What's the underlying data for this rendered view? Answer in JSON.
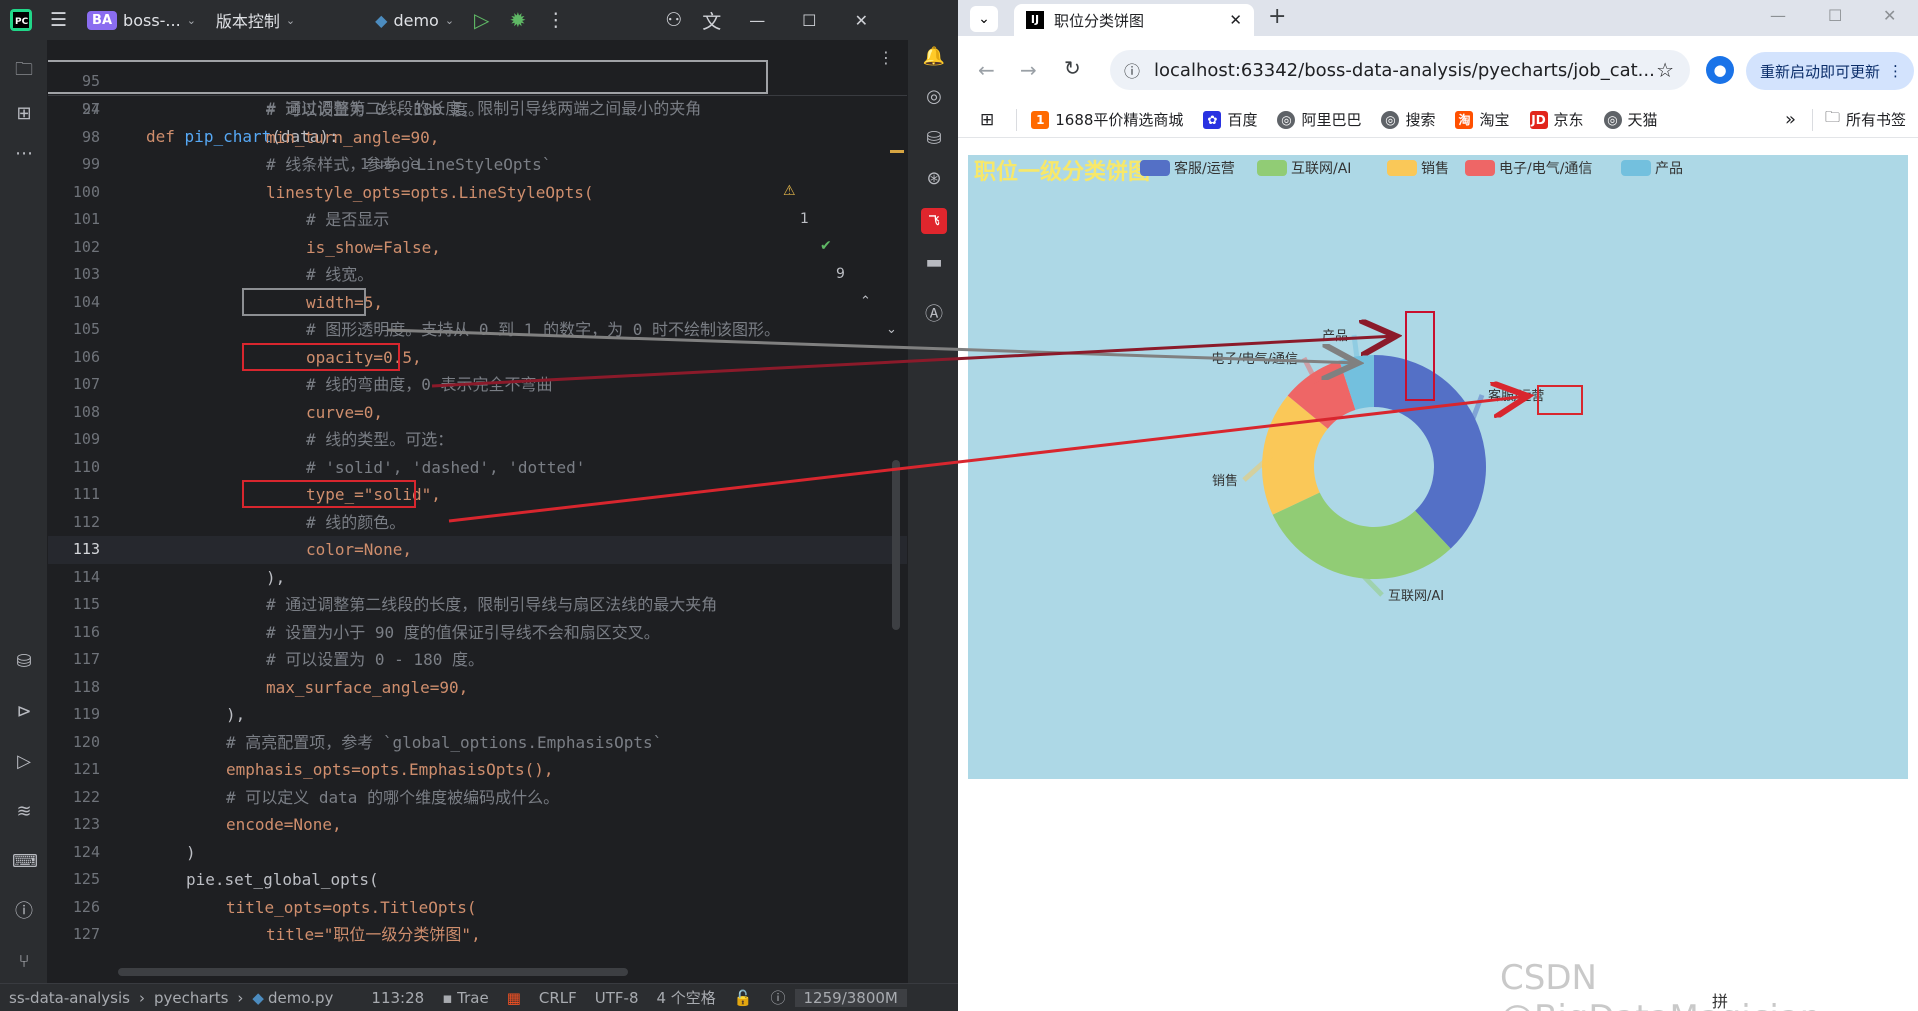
{
  "ide": {
    "titlebar": {
      "project_badge": "BA",
      "project_name": "boss-...",
      "vcs": "版本控制",
      "run_config": "demo"
    },
    "sticky": {
      "line1_num": "95",
      "line1_code": "# 通过调整第二线段的长度，限制引导线两端之间最小的夹角",
      "line2_num": "24",
      "line2_def": "def",
      "line2_fn": "pip_chart",
      "line2_rest": "(data):",
      "line2_usage": "1 usage",
      "warnings": "1",
      "checks": "9"
    },
    "lines": [
      {
        "n": "97",
        "code": "# 可以设置为 0 - 180 度。"
      },
      {
        "n": "98",
        "code": "min_turn_angle=90,"
      },
      {
        "n": "99",
        "code": "# 线条样式，参考 `LineStyleOpts`"
      },
      {
        "n": "100",
        "code": "linestyle_opts=opts.LineStyleOpts("
      },
      {
        "n": "101",
        "code": "# 是否显示"
      },
      {
        "n": "102",
        "code": "is_show=False,"
      },
      {
        "n": "103",
        "code": "# 线宽。"
      },
      {
        "n": "104",
        "code": "width=5,"
      },
      {
        "n": "105",
        "code": "# 图形透明度。支持从 0 到 1 的数字，为 0 时不绘制该图形。"
      },
      {
        "n": "106",
        "code": "opacity=0.5,"
      },
      {
        "n": "107",
        "code": "# 线的弯曲度，0 表示完全不弯曲"
      },
      {
        "n": "108",
        "code": "curve=0,"
      },
      {
        "n": "109",
        "code": "# 线的类型。可选："
      },
      {
        "n": "110",
        "code": "# 'solid', 'dashed', 'dotted'"
      },
      {
        "n": "111",
        "code": "type_=\"solid\","
      },
      {
        "n": "112",
        "code": "# 线的颜色。"
      },
      {
        "n": "113",
        "code": "color=None,"
      },
      {
        "n": "114",
        "code": "),"
      },
      {
        "n": "115",
        "code": "# 通过调整第二线段的长度，限制引导线与扇区法线的最大夹角"
      },
      {
        "n": "116",
        "code": "# 设置为小于 90 度的值保证引导线不会和扇区交叉。"
      },
      {
        "n": "117",
        "code": "# 可以设置为 0 - 180 度。"
      },
      {
        "n": "118",
        "code": "max_surface_angle=90,"
      },
      {
        "n": "119",
        "code": "),"
      },
      {
        "n": "120",
        "code": "# 高亮配置项，参考 `global_options.EmphasisOpts`"
      },
      {
        "n": "121",
        "code": "emphasis_opts=opts.EmphasisOpts(),"
      },
      {
        "n": "122",
        "code": "# 可以定义 data 的哪个维度被编码成什么。"
      },
      {
        "n": "123",
        "code": "encode=None,"
      },
      {
        "n": "124",
        "code": ")"
      },
      {
        "n": "125",
        "code": "pie.set_global_opts("
      },
      {
        "n": "126",
        "code": "title_opts=opts.TitleOpts("
      },
      {
        "n": "127",
        "code": "title=\"职位一级分类饼图\","
      }
    ],
    "statusbar": {
      "path1": "ss-data-analysis",
      "path2": "pyecharts",
      "file": "demo.py",
      "position": "113:28",
      "encoding_hint": "Trae",
      "line_sep": "CRLF",
      "encoding": "UTF-8",
      "indent": "4 个空格",
      "memory": "1259/3800M"
    }
  },
  "browser": {
    "tab_title": "职位分类饼图",
    "url": "localhost:63342/boss-data-analysis/pyecharts/job_cat...",
    "update_button": "重新启动即可更新",
    "bookmarks": [
      "1688平价精选商城",
      "百度",
      "阿里巴巴",
      "搜索",
      "淘宝",
      "京东",
      "天猫"
    ],
    "all_bookmarks": "所有书签"
  },
  "chart_data": {
    "type": "pie",
    "title": "职位一级分类饼图",
    "legend_position": "top",
    "radius": [
      "40%",
      "75%"
    ],
    "colors": [
      "#5470c6",
      "#91cc75",
      "#fac858",
      "#ee6666",
      "#73c0de"
    ],
    "slices": [
      {
        "name": "客服/运营",
        "value": 38
      },
      {
        "name": "互联网/AI",
        "value": 30
      },
      {
        "name": "销售",
        "value": 18
      },
      {
        "name": "电子/电气/通信",
        "value": 9
      },
      {
        "name": "产品",
        "value": 5
      }
    ]
  },
  "watermark": "CSDN @BigDataMagician",
  "ime": "拼"
}
